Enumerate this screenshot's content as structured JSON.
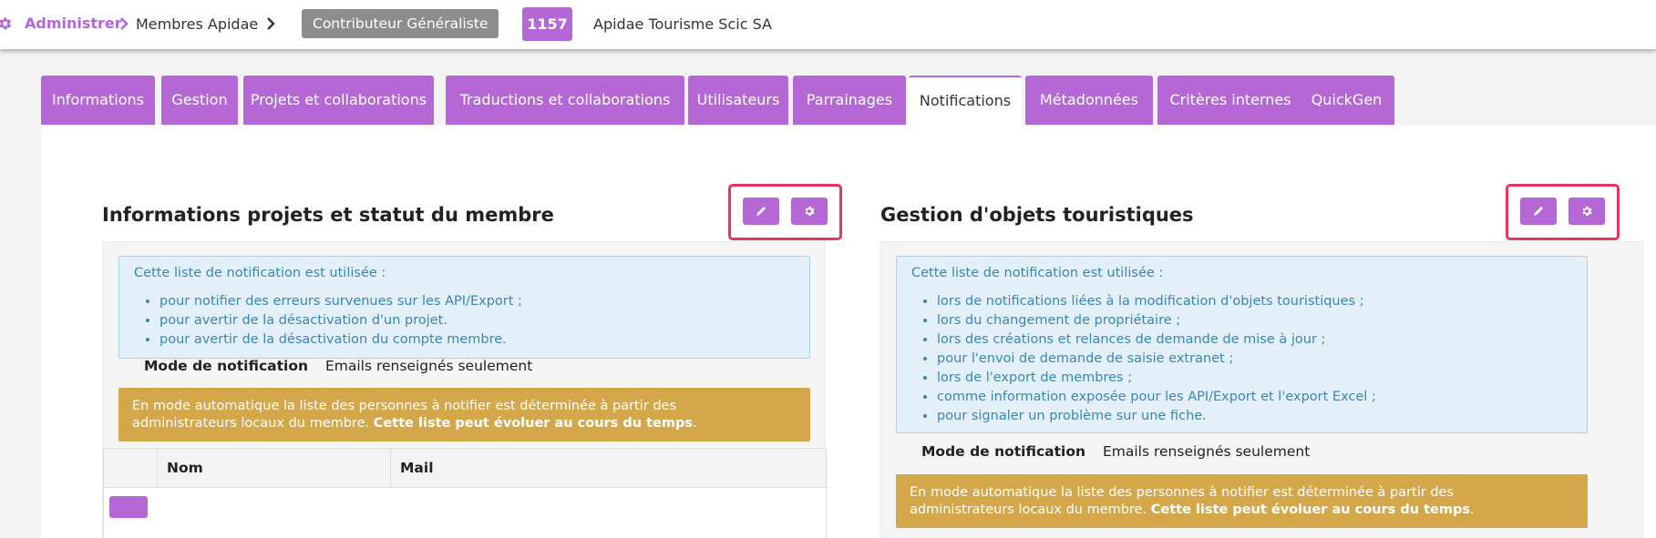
{
  "header": {
    "breadcrumb_admin": "Administrer",
    "breadcrumb_members": "Membres Apidae",
    "role_badge": "Contributeur Généraliste",
    "member_id": "1157",
    "org_name": "Apidae Tourisme Scic SA"
  },
  "tabs": [
    {
      "label": "Informations"
    },
    {
      "label": "Gestion"
    },
    {
      "label": "Projets et collaborations"
    },
    {
      "label": "Traductions et collaborations"
    },
    {
      "label": "Utilisateurs"
    },
    {
      "label": "Parrainages"
    },
    {
      "label": "Notifications",
      "active": true
    },
    {
      "label": "Métadonnées"
    },
    {
      "label": "Critères internes"
    },
    {
      "label": "QuickGen"
    }
  ],
  "left_section": {
    "title": "Informations projets et statut du membre",
    "info_intro": "Cette liste de notification est utilisée :",
    "info_items": [
      "pour notifier des erreurs survenues sur les API/Export ;",
      "pour avertir de la désactivation d'un projet.",
      "pour avertir de la désactivation du compte membre."
    ],
    "mode_label": "Mode de notification",
    "mode_value": "Emails renseignés seulement",
    "warn_text": "En mode automatique la liste des personnes à notifier est déterminée à partir des administrateurs locaux du membre.",
    "warn_bold": "Cette liste peut évoluer au cours du temps",
    "warn_end": ".",
    "table_headers": {
      "name": "Nom",
      "mail": "Mail"
    }
  },
  "right_section": {
    "title": "Gestion d'objets touristiques",
    "info_intro": "Cette liste de notification est utilisée :",
    "info_items": [
      "lors de notifications liées à la modification d'objets touristiques ;",
      "lors du changement de propriétaire ;",
      "lors des créations et relances de demande de mise à jour ;",
      "pour l'envoi de demande de saisie extranet ;",
      "lors de l'export de membres ;",
      "comme information exposée pour les API/Export et l'export Excel ;",
      "pour signaler un problème sur une fiche."
    ],
    "mode_label": "Mode de notification",
    "mode_value": "Emails renseignés seulement",
    "warn_text": "En mode automatique la liste des personnes à notifier est déterminée à partir des administrateurs locaux du membre.",
    "warn_bold": "Cette liste peut évoluer au cours du temps",
    "warn_end": "."
  },
  "colors": {
    "accent": "#b567d6",
    "warning": "#d4a74b",
    "info_bg": "#e3f0fa",
    "info_text": "#3a86b5",
    "highlight": "#e8355d",
    "role_badge": "#8d8d8d"
  },
  "icons": {
    "breadcrumb": "gear-icon",
    "separator": "chevron-right-icon",
    "edit": "pencil-icon",
    "settings": "gear-icon"
  }
}
